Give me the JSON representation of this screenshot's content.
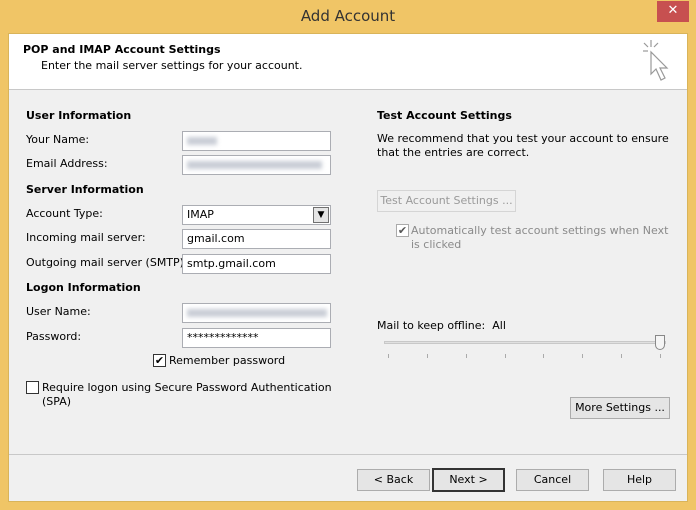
{
  "window": {
    "title": "Add Account",
    "close_icon": "close-icon"
  },
  "header": {
    "title": "POP and IMAP Account Settings",
    "subtitle": "Enter the mail server settings for your account.",
    "icon": "cursor-sparkle-icon"
  },
  "user_info": {
    "heading": "User Information",
    "name_label": "Your Name:",
    "email_label": "Email Address:"
  },
  "server_info": {
    "heading": "Server Information",
    "account_type_label": "Account Type:",
    "account_type": "IMAP",
    "incoming_label": "Incoming mail server:",
    "incoming": "gmail.com",
    "outgoing_label": "Outgoing mail server (SMTP):",
    "outgoing": "smtp.gmail.com"
  },
  "logon_info": {
    "heading": "Logon Information",
    "username_label": "User Name:",
    "password_label": "Password:",
    "password": "*************",
    "remember_label": "Remember password",
    "remember_checked": true,
    "spa_label": "Require logon using Secure Password Authentication (SPA)",
    "spa_checked": false
  },
  "test": {
    "heading": "Test Account Settings",
    "description": "We recommend that you test your account to ensure that the entries are correct.",
    "button": "Test Account Settings ...",
    "auto_label": "Automatically test account settings when Next is clicked",
    "auto_checked": true
  },
  "offline": {
    "label": "Mail to keep offline:",
    "value": "All",
    "slider_position": 1.0,
    "ticks": 8
  },
  "more_settings": "More Settings ...",
  "footer": {
    "back": "< Back",
    "next": "Next >",
    "cancel": "Cancel",
    "help": "Help"
  }
}
